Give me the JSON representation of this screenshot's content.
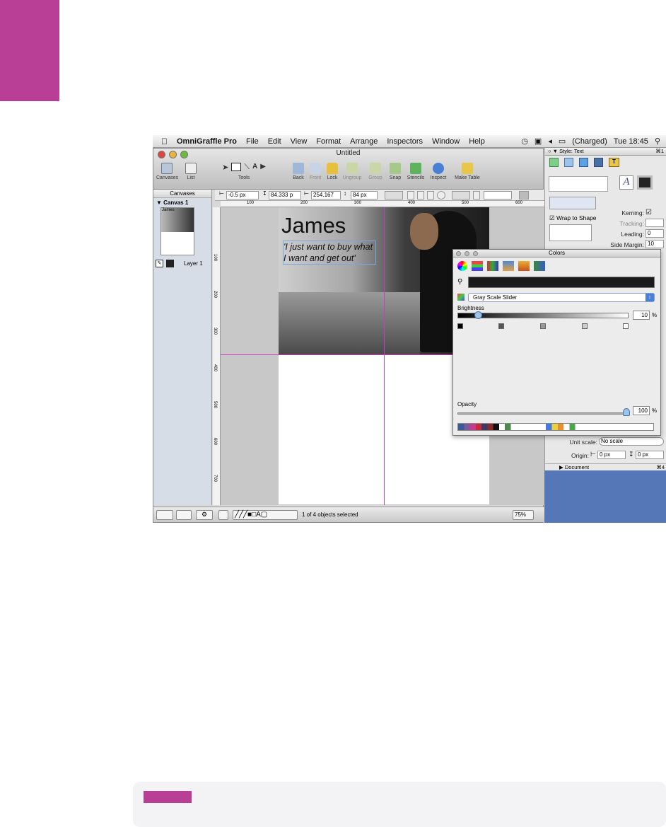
{
  "menubar": {
    "app_name": "OmniGraffle Pro",
    "menus": [
      "File",
      "Edit",
      "View",
      "Format",
      "Arrange",
      "Inspectors",
      "Window",
      "Help"
    ],
    "battery": "(Charged)",
    "clock": "Tue 18:45"
  },
  "window": {
    "title": "Untitled",
    "toolbar": {
      "canvases": "Canvases",
      "list": "List",
      "tools": "Tools",
      "back": "Back",
      "front": "Front",
      "lock": "Lock",
      "ungroup": "Ungroup",
      "group": "Group",
      "snap": "Snap",
      "stencils": "Stencils",
      "inspect": "Inspect",
      "make_table": "Make Table"
    },
    "geometry_bar": {
      "x": "-0.5 px",
      "y": "84.333 p",
      "width": "254.167",
      "height": "84 px"
    },
    "sidebar": {
      "header": "Canvases",
      "canvas_name": "Canvas 1",
      "thumb_title": "James",
      "layer_name": "Layer 1"
    },
    "ruler_h_ticks": [
      "100",
      "200",
      "300",
      "400",
      "500",
      "600"
    ],
    "ruler_v_ticks": [
      "100",
      "200",
      "300",
      "400",
      "500",
      "600",
      "700"
    ],
    "canvas": {
      "title_text": "James",
      "quote_text": "'I just want to buy what I want and get out'"
    },
    "status": {
      "selection": "1 of 4 objects selected",
      "zoom": "75%"
    }
  },
  "inspector": {
    "header": "Style: Text",
    "wrap_to_shape": "Wrap to Shape",
    "kerning": "Kerning:",
    "tracking": "Tracking:",
    "leading": "Leading:",
    "leading_value": "0",
    "side_margin": "Side Margin:",
    "side_margin_value": "10",
    "unit_scale": "Unit scale:",
    "unit_scale_value": "No scale",
    "origin": "Origin:",
    "origin_x": "0 px",
    "origin_y": "0 px",
    "document": "Document",
    "shortcut_top": "⌘1",
    "shortcut_bottom": "⌘4"
  },
  "colors_panel": {
    "title": "Colors",
    "mode": "Gray Scale Slider",
    "brightness_label": "Brightness",
    "brightness_value": "10",
    "opacity_label": "Opacity",
    "opacity_value": "100",
    "percent": "%"
  },
  "colors": {
    "accent_magenta": "#b83f95",
    "desktop_blue": "#5577b8"
  }
}
